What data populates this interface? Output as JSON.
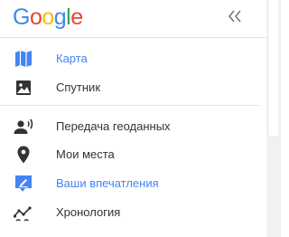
{
  "header": {
    "logo_letters": [
      "G",
      "o",
      "o",
      "g",
      "l",
      "e"
    ],
    "logo_colors": [
      "#4285f4",
      "#ea4335",
      "#fbbc05",
      "#4285f4",
      "#34a853",
      "#ea4335"
    ],
    "collapse_icon": "double-chevron-left-icon"
  },
  "menu": {
    "group1": [
      {
        "label": "Карта",
        "icon": "map-icon",
        "active": true
      },
      {
        "label": "Спутник",
        "icon": "satellite-image-icon",
        "active": false
      }
    ],
    "group2": [
      {
        "label": "Передача геоданных",
        "icon": "location-sharing-icon",
        "active": false
      },
      {
        "label": "Мои места",
        "icon": "place-pin-icon",
        "active": false
      },
      {
        "label": "Ваши впечатления",
        "icon": "your-contributions-icon",
        "active": true
      },
      {
        "label": "Хронология",
        "icon": "timeline-icon",
        "active": false
      }
    ]
  },
  "colors": {
    "accent": "#4285f4",
    "icon_dark": "#333333",
    "text": "#333333",
    "divider": "#e0e0e0"
  }
}
